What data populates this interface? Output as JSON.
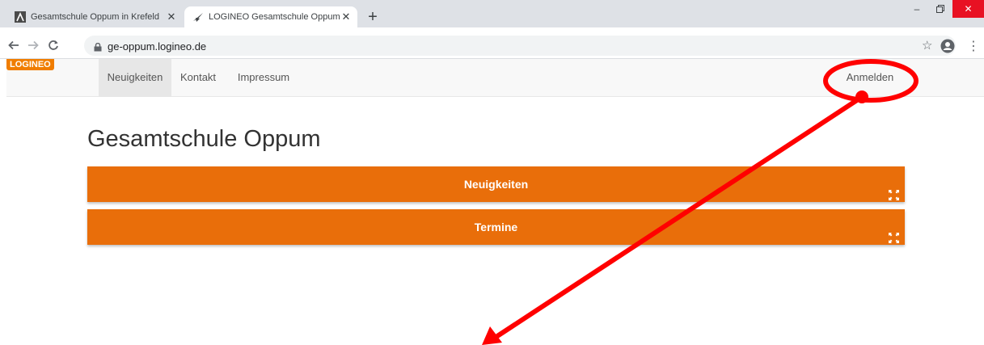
{
  "browser": {
    "tabs": [
      {
        "title": "Gesamtschule Oppum in Krefeld",
        "active": false
      },
      {
        "title": "LOGINEO Gesamtschule Oppum",
        "active": true
      }
    ],
    "new_tab_label": "+",
    "address": "ge-oppum.logineo.de"
  },
  "site": {
    "logo": "LOGINEO",
    "nav": {
      "news": "Neuigkeiten",
      "contact": "Kontakt",
      "imprint": "Impressum",
      "login": "Anmelden"
    },
    "title": "Gesamtschule Oppum",
    "panels": [
      {
        "label": "Neuigkeiten"
      },
      {
        "label": "Termine"
      }
    ]
  },
  "colors": {
    "accent": "#e96e0a",
    "logo": "#f07d00",
    "annotation": "#ff0000"
  },
  "icons": [
    "back-arrow-icon",
    "forward-arrow-icon",
    "reload-icon",
    "lock-icon",
    "star-icon",
    "account-icon",
    "menu-icon",
    "expand-icon"
  ]
}
